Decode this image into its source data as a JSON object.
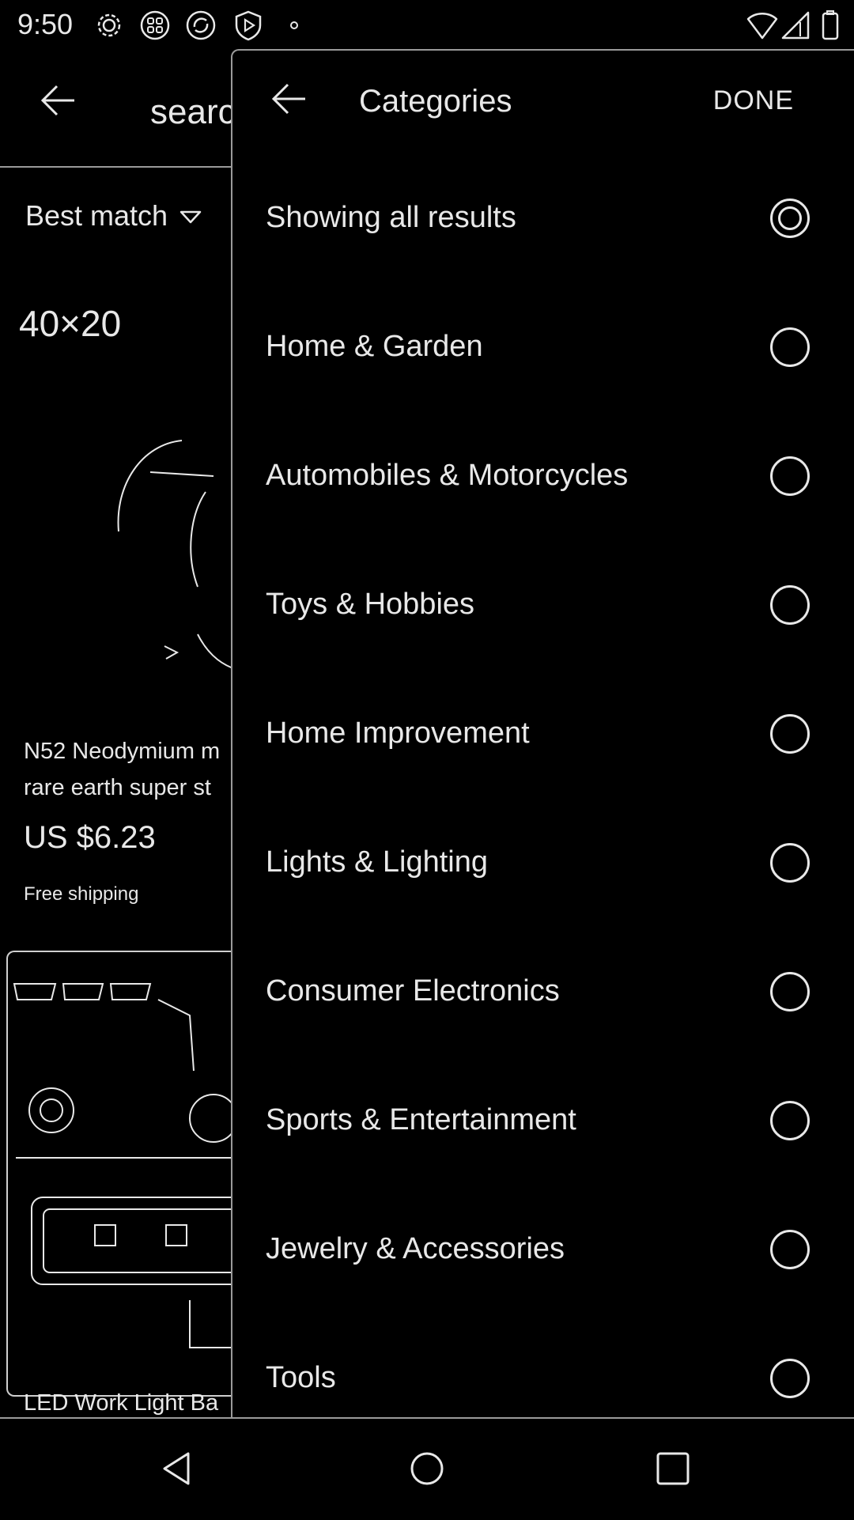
{
  "status_bar": {
    "time": "9:50",
    "icons": [
      "settings-icon",
      "app-grid-icon",
      "sync-icon",
      "play-shield-icon",
      "dot-icon",
      "wifi-icon",
      "cell-signal-icon",
      "battery-icon"
    ]
  },
  "background": {
    "search_text": "search",
    "sort_label": "Best match",
    "size_label": "40×20",
    "product_title_line1": "N52 Neodymium m",
    "product_title_line2": "rare earth super st",
    "product_price": "US $6.23",
    "product_shipping": "Free shipping",
    "product2_title": "LED Work Light Ba"
  },
  "drawer": {
    "title": "Categories",
    "done_label": "DONE",
    "selected_index": 0,
    "categories": [
      {
        "label": "Showing all results"
      },
      {
        "label": "Home & Garden"
      },
      {
        "label": "Automobiles & Motorcycles"
      },
      {
        "label": "Toys & Hobbies"
      },
      {
        "label": "Home Improvement"
      },
      {
        "label": "Lights & Lighting"
      },
      {
        "label": "Consumer Electronics"
      },
      {
        "label": "Sports & Entertainment"
      },
      {
        "label": "Jewelry & Accessories"
      },
      {
        "label": "Tools"
      }
    ]
  },
  "nav_bar": {
    "buttons": [
      "back-nav-icon",
      "home-nav-icon",
      "recents-nav-icon"
    ]
  },
  "colors": {
    "background": "#000000",
    "foreground": "#e8e8e8",
    "divider": "#9a9a9a"
  }
}
